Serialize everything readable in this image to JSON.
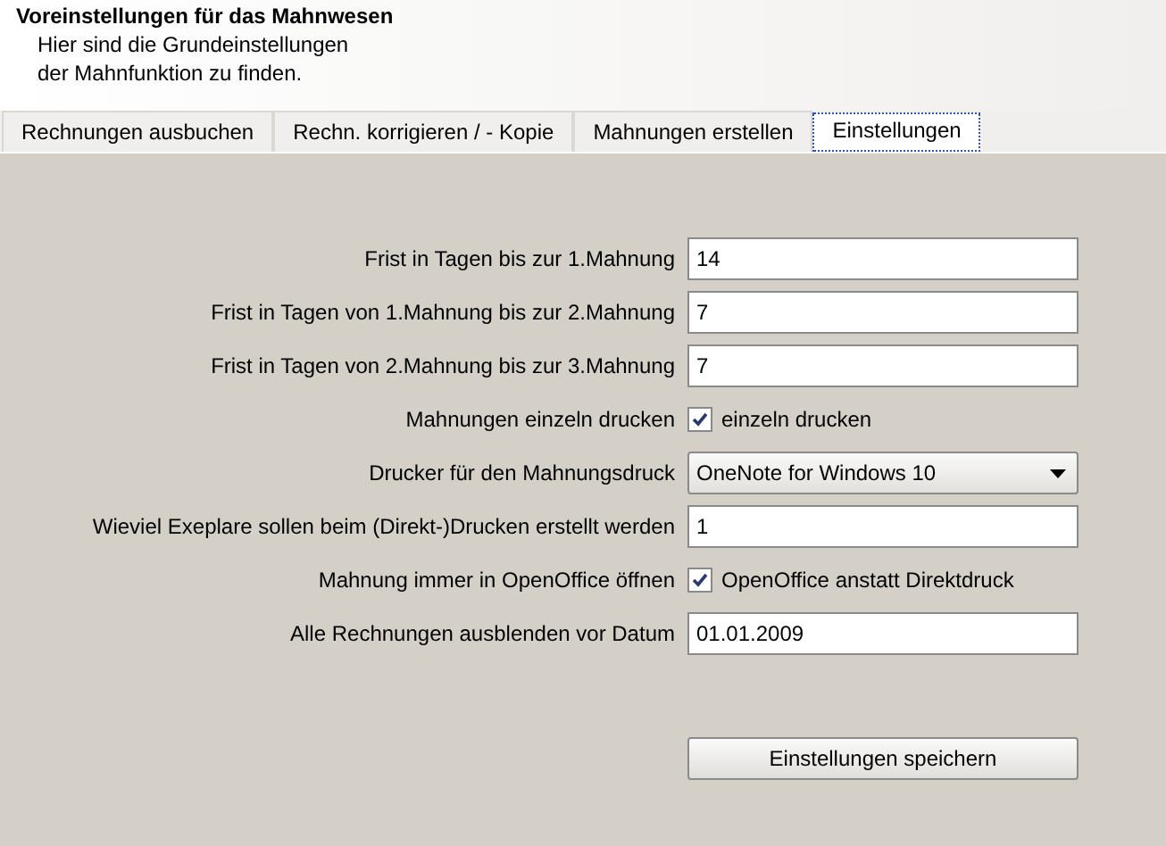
{
  "header": {
    "title": "Voreinstellungen für das Mahnwesen",
    "description_lines": [
      "Hier sind die Grundeinstellungen",
      "der Mahnfunktion zu finden."
    ]
  },
  "tabs": [
    {
      "label": "Rechnungen ausbuchen",
      "selected": false
    },
    {
      "label": "Rechn. korrigieren / - Kopie",
      "selected": false
    },
    {
      "label": "Mahnungen erstellen",
      "selected": false
    },
    {
      "label": "Einstellungen",
      "selected": true
    }
  ],
  "settings": [
    {
      "kind": "text",
      "label": "Frist in Tagen bis zur 1.Mahnung",
      "value": "14"
    },
    {
      "kind": "text",
      "label": "Frist in Tagen von 1.Mahnung bis zur 2.Mahnung",
      "value": "7"
    },
    {
      "kind": "text",
      "label": "Frist in Tagen von 2.Mahnung bis zur 3.Mahnung",
      "value": "7"
    },
    {
      "kind": "checkbox",
      "label": "Mahnungen einzeln drucken",
      "option": "einzeln drucken",
      "checked": true
    },
    {
      "kind": "select",
      "label": "Drucker für den Mahnungsdruck",
      "value": "OneNote for Windows 10"
    },
    {
      "kind": "text",
      "label": "Wieviel Exeplare sollen beim (Direkt-)Drucken erstellt werden",
      "value": "1"
    },
    {
      "kind": "checkbox",
      "label": "Mahnung immer in OpenOffice öffnen",
      "option": "OpenOffice anstatt Direktdruck",
      "checked": true
    },
    {
      "kind": "text",
      "label": "Alle Rechnungen ausblenden vor Datum",
      "value": "01.01.2009"
    }
  ],
  "save_button": "Einstellungen speichern"
}
